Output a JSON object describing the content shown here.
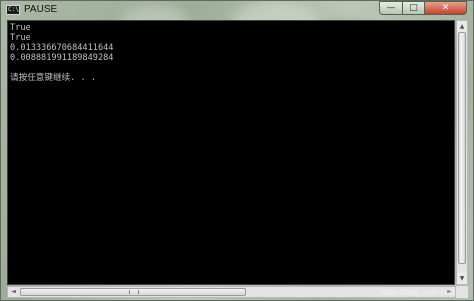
{
  "window": {
    "title": "PAUSE",
    "icon_text": "C:\\",
    "controls": {
      "minimize": "—",
      "maximize": "□",
      "close": "✕"
    }
  },
  "console": {
    "lines": [
      "True",
      "True",
      "0.013336670684411644",
      "0.008881991189849284",
      "",
      "请按任意键继续. . ."
    ]
  },
  "scrollbars": {
    "up_arrow": "▲",
    "down_arrow": "▼",
    "left_arrow": "◄",
    "right_arrow": "►"
  },
  "watermark": "https://blog.csdn.net/..."
}
